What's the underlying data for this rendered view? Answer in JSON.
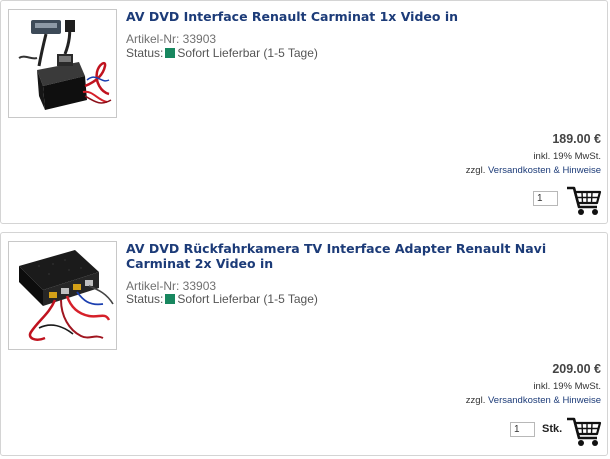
{
  "products": [
    {
      "title": "AV DVD Interface Renault Carminat 1x Video in",
      "article": "Artikel-Nr: 33903",
      "status_label": "Status:",
      "status_text": "Sofort Lieferbar (1-5 Tage)",
      "status_color": "#18875f",
      "price": "189.00 €",
      "tax": "inkl. 19% MwSt.",
      "ship_prefix": "zzgl.",
      "ship_link": "Versandkosten & Hinweise",
      "qty": "1",
      "cart_icon": "shopping-cart-icon"
    },
    {
      "title": "AV DVD Rückfahrkamera TV Interface Adapter Renault Navi Carminat 2x Video in",
      "article": "Artikel-Nr: 33903",
      "status_label": "Status:",
      "status_text": "Sofort Lieferbar (1-5 Tage)",
      "status_color": "#18875f",
      "price": "209.00 €",
      "tax": "inkl. 19% MwSt.",
      "ship_prefix": "zzgl.",
      "ship_link": "Versandkosten & Hinweise",
      "qty": "1",
      "unit": "Stk.",
      "cart_icon": "shopping-cart-icon"
    }
  ],
  "colors": {
    "title": "#1c3b78",
    "border": "#d4d4d4",
    "link": "#1c3b78"
  }
}
